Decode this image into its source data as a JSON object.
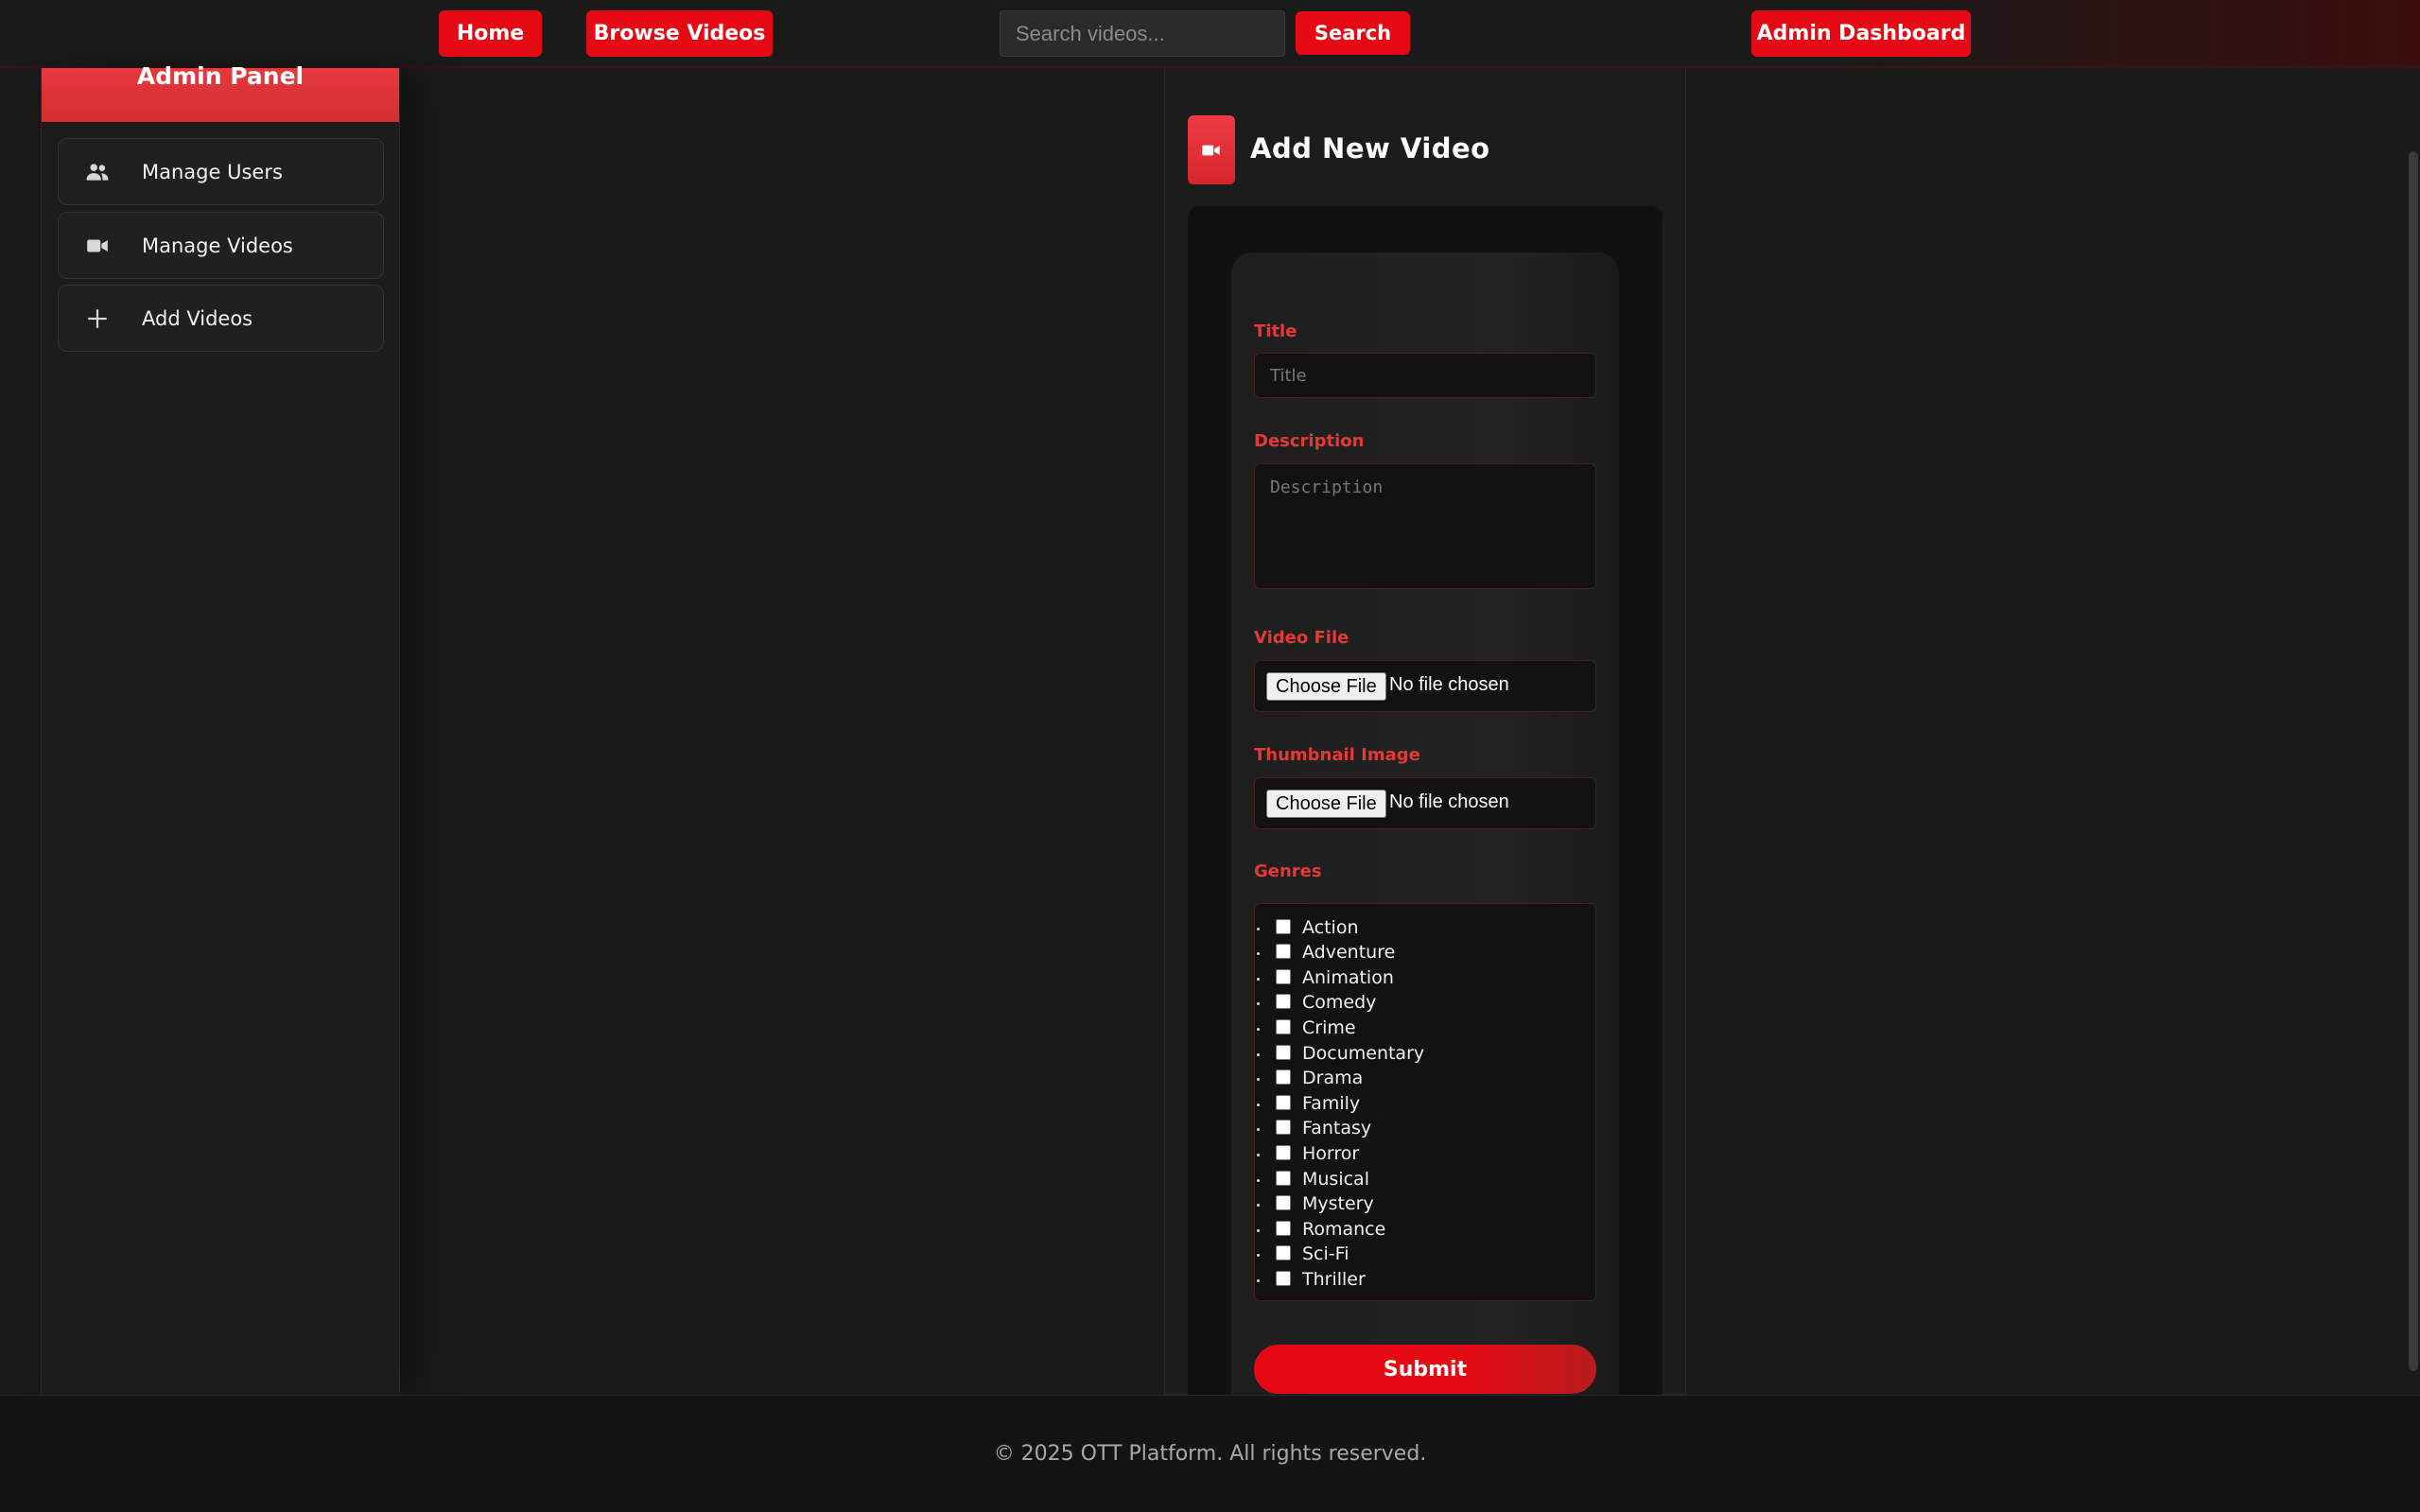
{
  "navbar": {
    "home_label": "Home",
    "browse_label": "Browse Videos",
    "search_placeholder": "Search videos...",
    "search_button": "Search",
    "admin_dashboard_label": "Admin Dashboard"
  },
  "sidebar": {
    "title": "Admin Panel",
    "items": [
      {
        "label": "Manage Users",
        "icon": "users-icon"
      },
      {
        "label": "Manage Videos",
        "icon": "video-camera-icon"
      },
      {
        "label": "Add Videos",
        "icon": "plus-icon"
      }
    ]
  },
  "form": {
    "heading": "Add New Video",
    "title_label": "Title",
    "title_placeholder": "Title",
    "title_value": "",
    "description_label": "Description",
    "description_placeholder": "Description",
    "description_value": "",
    "video_file_label": "Video File",
    "thumbnail_label": "Thumbnail Image",
    "choose_file": "Choose File",
    "no_file": "No file chosen",
    "genres_label": "Genres",
    "genres": [
      "Action",
      "Adventure",
      "Animation",
      "Comedy",
      "Crime",
      "Documentary",
      "Drama",
      "Family",
      "Fantasy",
      "Horror",
      "Musical",
      "Mystery",
      "Romance",
      "Sci-Fi",
      "Thriller"
    ],
    "submit_label": "Submit"
  },
  "footer": {
    "text": "© 2025 OTT Platform. All rights reserved."
  },
  "colors": {
    "accent": "#e50914",
    "label_red": "#e53935",
    "background": "#1a1a1b"
  }
}
